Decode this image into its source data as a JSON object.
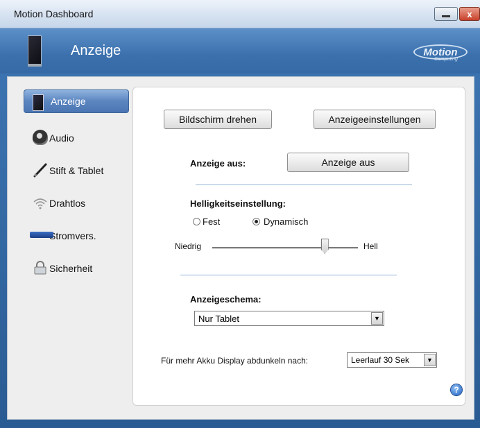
{
  "window": {
    "title": "Motion Dashboard",
    "minimize_glyph": "",
    "close_glyph": "x"
  },
  "header": {
    "title": "Anzeige",
    "icon": "tablet-display-icon",
    "logo_text": "Motion",
    "logo_sub": "Computing"
  },
  "sidebar": {
    "items": [
      {
        "label": "Anzeige",
        "icon": "tablet-display-icon",
        "active": true
      },
      {
        "label": "Audio",
        "icon": "speaker-icon",
        "active": false
      },
      {
        "label": "Stift & Tablet",
        "icon": "pen-icon",
        "active": false
      },
      {
        "label": "Drahtlos",
        "icon": "wifi-icon",
        "active": false
      },
      {
        "label": "Stromvers.",
        "icon": "battery-icon",
        "active": false
      },
      {
        "label": "Sicherheit",
        "icon": "lock-icon",
        "active": false
      }
    ]
  },
  "panel": {
    "rotate_button": "Bildschirm drehen",
    "settings_button": "Anzeigeeinstellungen",
    "display_off_label": "Anzeige aus:",
    "display_off_button": "Anzeige aus",
    "brightness_label": "Helligkeitseinstellung:",
    "radio_fixed": "Fest",
    "radio_dynamic": "Dynamisch",
    "selected_mode": "Dynamisch",
    "slider_low": "Niedrig",
    "slider_high": "Hell",
    "slider_value": 0.77,
    "scheme_label": "Anzeigeschema:",
    "scheme_value": "Nur Tablet",
    "dim_label": "Für mehr Akku Display abdunkeln nach:",
    "dim_value": "Leerlauf 30 Sek",
    "help_glyph": "?"
  },
  "colors": {
    "accent": "#4a76b3",
    "titlebar": "#d6e2f1",
    "header": "#3b70ad"
  }
}
